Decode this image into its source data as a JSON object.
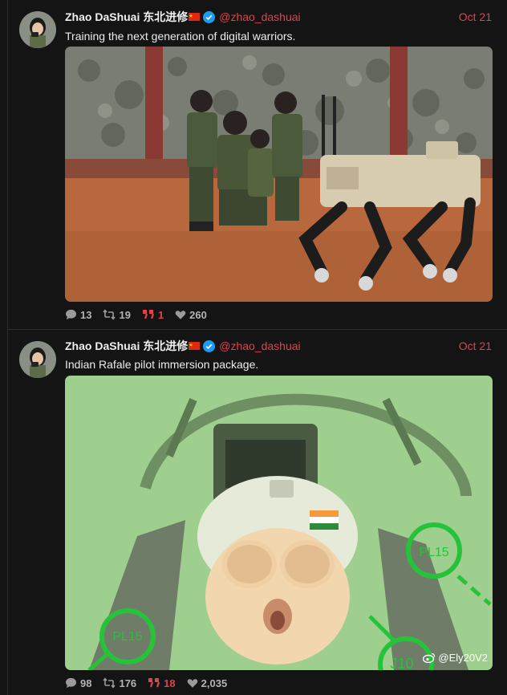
{
  "posts": [
    {
      "author": {
        "display_name": "Zhao DaShuai 东北进修",
        "flag_icon": "china-flag-icon",
        "verified": true,
        "handle": "@zhao_dashuai"
      },
      "date": "Oct 21",
      "text": "Training the next generation of digital warriors.",
      "media": {
        "kind": "photo",
        "subject": "kids-with-robot-dog-photo"
      },
      "stats": {
        "replies": "13",
        "reposts": "19",
        "quotes": "1",
        "likes": "260"
      }
    },
    {
      "author": {
        "display_name": "Zhao DaShuai 东北进修",
        "flag_icon": "china-flag-icon",
        "verified": true,
        "handle": "@zhao_dashuai"
      },
      "date": "Oct 21",
      "text": "Indian Rafale pilot immersion package.",
      "media": {
        "kind": "photo",
        "subject": "cat-pilot-cockpit-photo",
        "overlay_labels": [
          "PL15",
          "PL15",
          "J10"
        ],
        "watermark": "@Ely20V2"
      },
      "stats": {
        "replies": "98",
        "reposts": "176",
        "quotes": "18",
        "likes": "2,035"
      }
    }
  ],
  "colors": {
    "background": "#141414",
    "accent": "#e0424b",
    "verified": "#1d9bf0",
    "muted": "#b4b4b4"
  }
}
